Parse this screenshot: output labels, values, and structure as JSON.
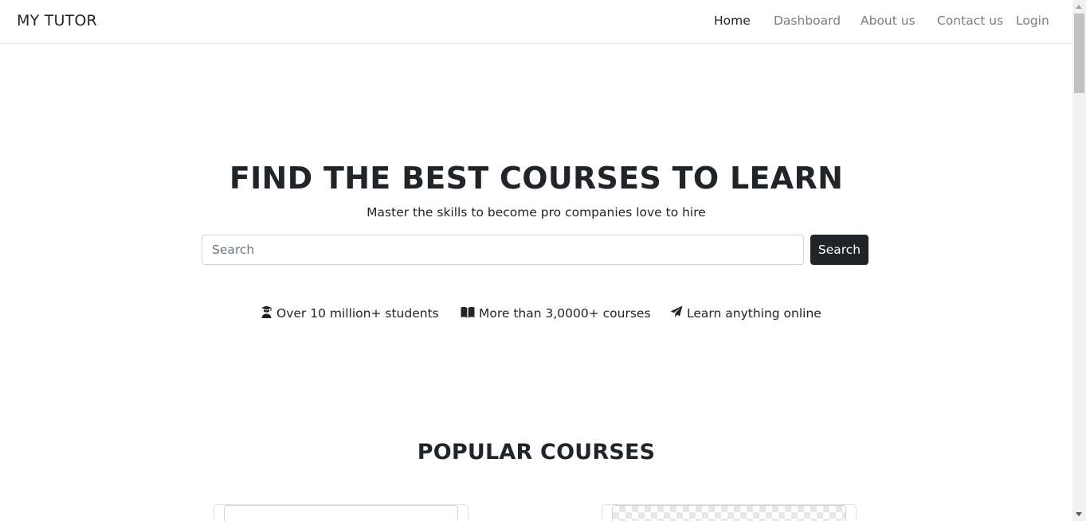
{
  "navbar": {
    "brand": "MY TUTOR",
    "links": [
      {
        "label": "Home",
        "active": true
      },
      {
        "label": "Dashboard",
        "active": false
      },
      {
        "label": "About us",
        "active": false
      },
      {
        "label": "Contact us",
        "active": false
      },
      {
        "label": "Login",
        "active": false
      }
    ]
  },
  "hero": {
    "title": "FIND THE BEST COURSES TO LEARN",
    "subtitle": "Master the skills to become pro companies love to hire",
    "search": {
      "placeholder": "Search",
      "value": "",
      "button_label": "Search"
    },
    "features": [
      {
        "icon": "graduate-icon",
        "label": "Over 10 million+ students"
      },
      {
        "icon": "book-open-icon",
        "label": "More than 3,0000+ courses"
      },
      {
        "icon": "paper-plane-icon",
        "label": "Learn anything online"
      }
    ]
  },
  "popular": {
    "title": "POPULAR COURSES"
  },
  "colors": {
    "primary_dark": "#212529",
    "muted_nav": "#7a7d80",
    "border": "#dee2e6"
  }
}
